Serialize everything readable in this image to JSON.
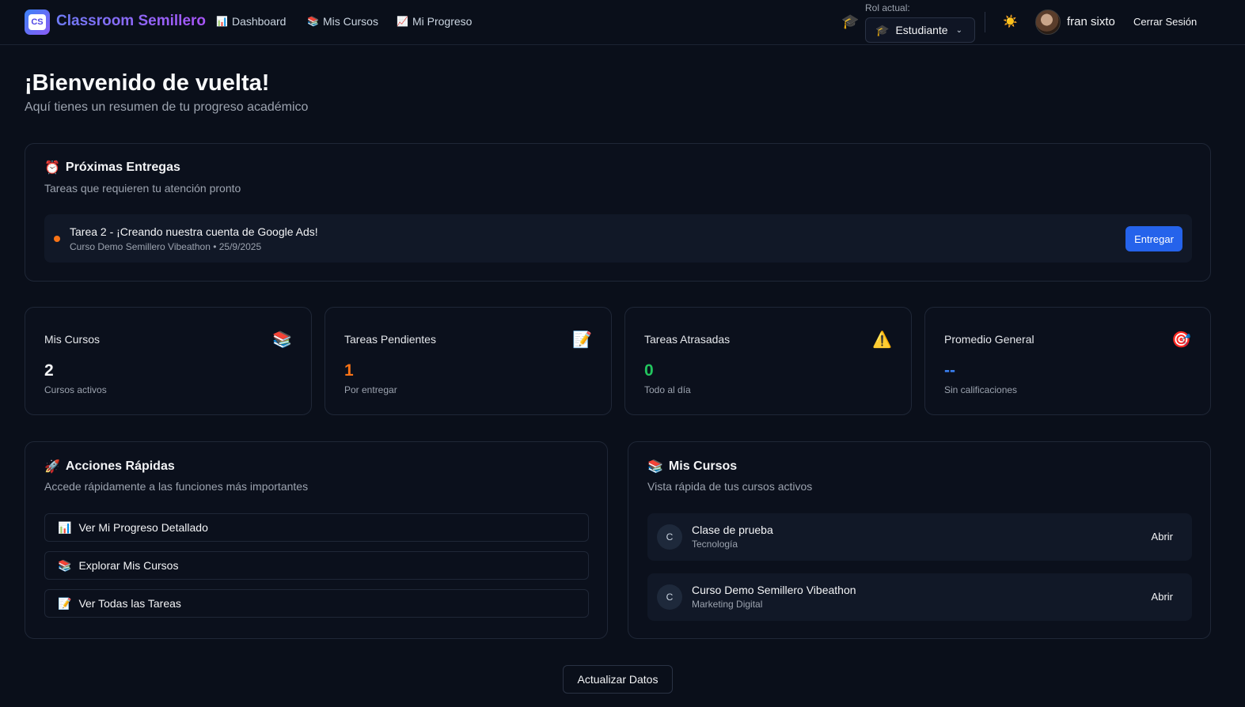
{
  "header": {
    "logo_text": "CS",
    "brand": "Classroom Semillero",
    "nav": [
      {
        "icon": "📊",
        "label": "Dashboard"
      },
      {
        "icon": "📚",
        "label": "Mis Cursos"
      },
      {
        "icon": "📈",
        "label": "Mi Progreso"
      }
    ],
    "role_icon": "🎓",
    "role_label": "Rol actual:",
    "role_value": "Estudiante",
    "theme_icon": "☀️",
    "username": "fran sixto",
    "logout_label": "Cerrar Sesión"
  },
  "welcome": {
    "title": "¡Bienvenido de vuelta!",
    "subtitle": "Aquí tienes un resumen de tu progreso académico"
  },
  "upcoming": {
    "icon": "⏰",
    "title": "Próximas Entregas",
    "subtitle": "Tareas que requieren tu atención pronto",
    "items": [
      {
        "title": "Tarea 2 - ¡Creando nuestra cuenta de Google Ads!",
        "meta": "Curso Demo Semillero Vibeathon • 25/9/2025",
        "action": "Entregar"
      }
    ]
  },
  "stats": [
    {
      "label": "Mis Cursos",
      "icon": "📚",
      "value": "2",
      "sub": "Cursos activos",
      "color": "#f3f4f6"
    },
    {
      "label": "Tareas Pendientes",
      "icon": "📝",
      "value": "1",
      "sub": "Por entregar",
      "color": "#f97316"
    },
    {
      "label": "Tareas Atrasadas",
      "icon": "⚠️",
      "value": "0",
      "sub": "Todo al día",
      "color": "#22c55e"
    },
    {
      "label": "Promedio General",
      "icon": "🎯",
      "value": "--",
      "sub": "Sin calificaciones",
      "color": "#3b82f6"
    }
  ],
  "quick_actions": {
    "icon": "🚀",
    "title": "Acciones Rápidas",
    "subtitle": "Accede rápidamente a las funciones más importantes",
    "items": [
      {
        "icon": "📊",
        "label": "Ver Mi Progreso Detallado"
      },
      {
        "icon": "📚",
        "label": "Explorar Mis Cursos"
      },
      {
        "icon": "📝",
        "label": "Ver Todas las Tareas"
      }
    ]
  },
  "my_courses": {
    "icon": "📚",
    "title": "Mis Cursos",
    "subtitle": "Vista rápida de tus cursos activos",
    "items": [
      {
        "initial": "C",
        "name": "Clase de prueba",
        "category": "Tecnología",
        "action": "Abrir"
      },
      {
        "initial": "C",
        "name": "Curso Demo Semillero Vibeathon",
        "category": "Marketing Digital",
        "action": "Abrir"
      }
    ]
  },
  "refresh_label": "Actualizar Datos"
}
